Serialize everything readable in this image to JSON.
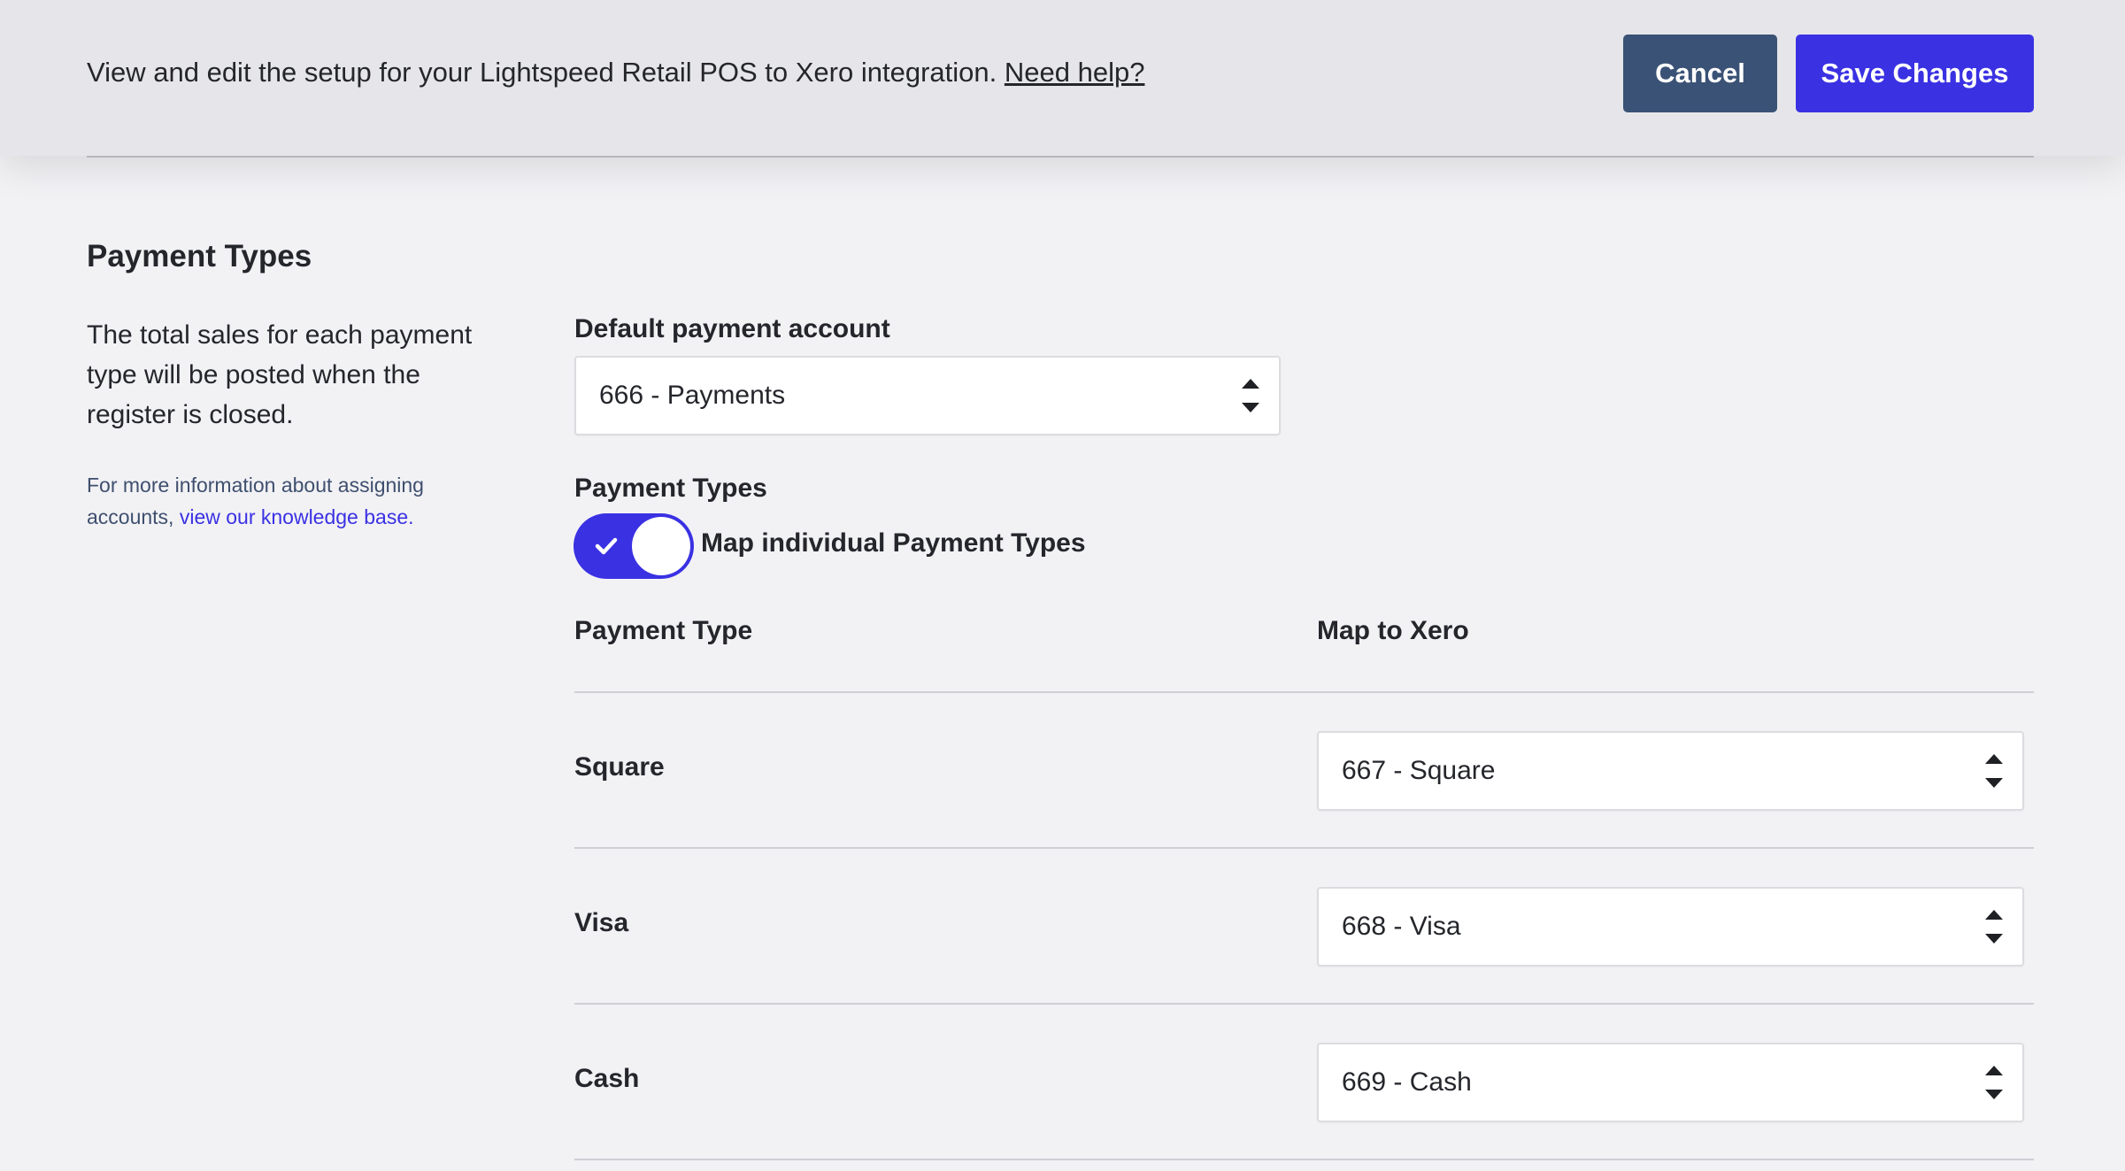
{
  "header": {
    "description": "View and edit the setup for your Lightspeed Retail POS to Xero integration.",
    "help_link": "Need help?",
    "cancel_label": "Cancel",
    "save_label": "Save Changes"
  },
  "section": {
    "title": "Payment Types",
    "description": "The total sales for each payment type will be posted when the register is closed.",
    "help_prefix": "For more information about assigning accounts,",
    "help_link": "view our knowledge base."
  },
  "default_account": {
    "label": "Default payment account",
    "value": "666 - Payments"
  },
  "payment_types_toggle": {
    "label": "Payment Types",
    "toggle_label": "Map individual Payment Types",
    "enabled": true
  },
  "mapping_table": {
    "columns": [
      "Payment Type",
      "Map to Xero"
    ],
    "rows": [
      {
        "payment_type": "Square",
        "xero_account": "667 - Square"
      },
      {
        "payment_type": "Visa",
        "xero_account": "668 - Visa"
      },
      {
        "payment_type": "Cash",
        "xero_account": "669 - Cash"
      }
    ]
  },
  "colors": {
    "accent": "#3a31e3",
    "cancel_button": "#3a5275",
    "header_background": "#e6e6ea",
    "page_background": "#f2f2f5"
  },
  "icons": {
    "select_arrows": "sort-arrows-icon",
    "toggle_check": "checkmark-icon"
  }
}
